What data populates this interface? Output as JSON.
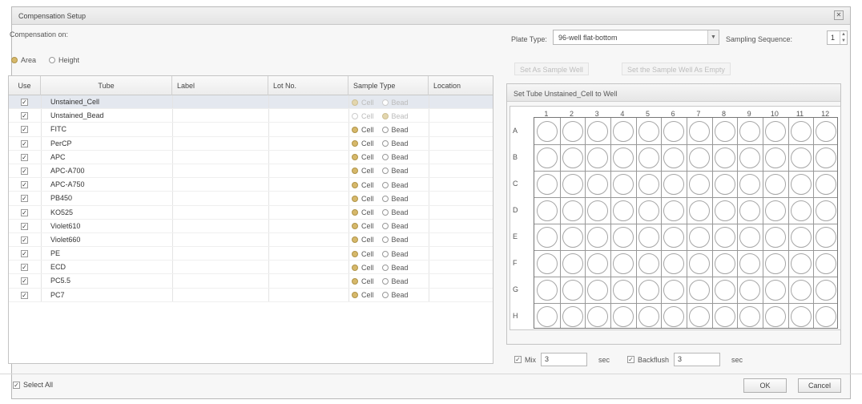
{
  "window": {
    "title": "Compensation Setup",
    "close_icon": "close-icon"
  },
  "compensation": {
    "label": "Compensation on:",
    "options": [
      {
        "label": "Area",
        "selected": true
      },
      {
        "label": "Height",
        "selected": false
      }
    ]
  },
  "table": {
    "headers": {
      "use": "Use",
      "tube": "Tube",
      "label": "Label",
      "lot": "Lot No.",
      "sample_type": "Sample Type",
      "location": "Location"
    },
    "cell_label": "Cell",
    "bead_label": "Bead",
    "rows": [
      {
        "tube": "Unstained_Cell",
        "checked": true,
        "type": "Cell",
        "disabled": true,
        "selected": true
      },
      {
        "tube": "Unstained_Bead",
        "checked": true,
        "type": "Bead",
        "disabled": true,
        "selected": false
      },
      {
        "tube": "FITC",
        "checked": true,
        "type": "Cell",
        "disabled": false,
        "selected": false
      },
      {
        "tube": "PerCP",
        "checked": true,
        "type": "Cell",
        "disabled": false,
        "selected": false
      },
      {
        "tube": "APC",
        "checked": true,
        "type": "Cell",
        "disabled": false,
        "selected": false
      },
      {
        "tube": "APC-A700",
        "checked": true,
        "type": "Cell",
        "disabled": false,
        "selected": false
      },
      {
        "tube": "APC-A750",
        "checked": true,
        "type": "Cell",
        "disabled": false,
        "selected": false
      },
      {
        "tube": "PB450",
        "checked": true,
        "type": "Cell",
        "disabled": false,
        "selected": false
      },
      {
        "tube": "KO525",
        "checked": true,
        "type": "Cell",
        "disabled": false,
        "selected": false
      },
      {
        "tube": "Violet610",
        "checked": true,
        "type": "Cell",
        "disabled": false,
        "selected": false
      },
      {
        "tube": "Violet660",
        "checked": true,
        "type": "Cell",
        "disabled": false,
        "selected": false
      },
      {
        "tube": "PE",
        "checked": true,
        "type": "Cell",
        "disabled": false,
        "selected": false
      },
      {
        "tube": "ECD",
        "checked": true,
        "type": "Cell",
        "disabled": false,
        "selected": false
      },
      {
        "tube": "PC5.5",
        "checked": true,
        "type": "Cell",
        "disabled": false,
        "selected": false
      },
      {
        "tube": "PC7",
        "checked": true,
        "type": "Cell",
        "disabled": false,
        "selected": false
      }
    ]
  },
  "select_all": {
    "label": "Select All",
    "checked": true
  },
  "plate": {
    "type_label": "Plate Type:",
    "type_value": "96-well flat-bottom",
    "sequence_label": "Sampling Sequence:",
    "sequence_value": "1",
    "set_sample_well": "Set As Sample Well",
    "set_empty": "Set the Sample Well As Empty",
    "panel_title": "Set Tube Unstained_Cell to Well",
    "columns": [
      "1",
      "2",
      "3",
      "4",
      "5",
      "6",
      "7",
      "8",
      "9",
      "10",
      "11",
      "12"
    ],
    "rows": [
      "A",
      "B",
      "C",
      "D",
      "E",
      "F",
      "G",
      "H"
    ]
  },
  "mix": {
    "label": "Mix",
    "checked": true,
    "value": "3",
    "unit": "sec"
  },
  "backflush": {
    "label": "Backflush",
    "checked": true,
    "value": "3",
    "unit": "sec"
  },
  "buttons": {
    "ok": "OK",
    "cancel": "Cancel"
  }
}
